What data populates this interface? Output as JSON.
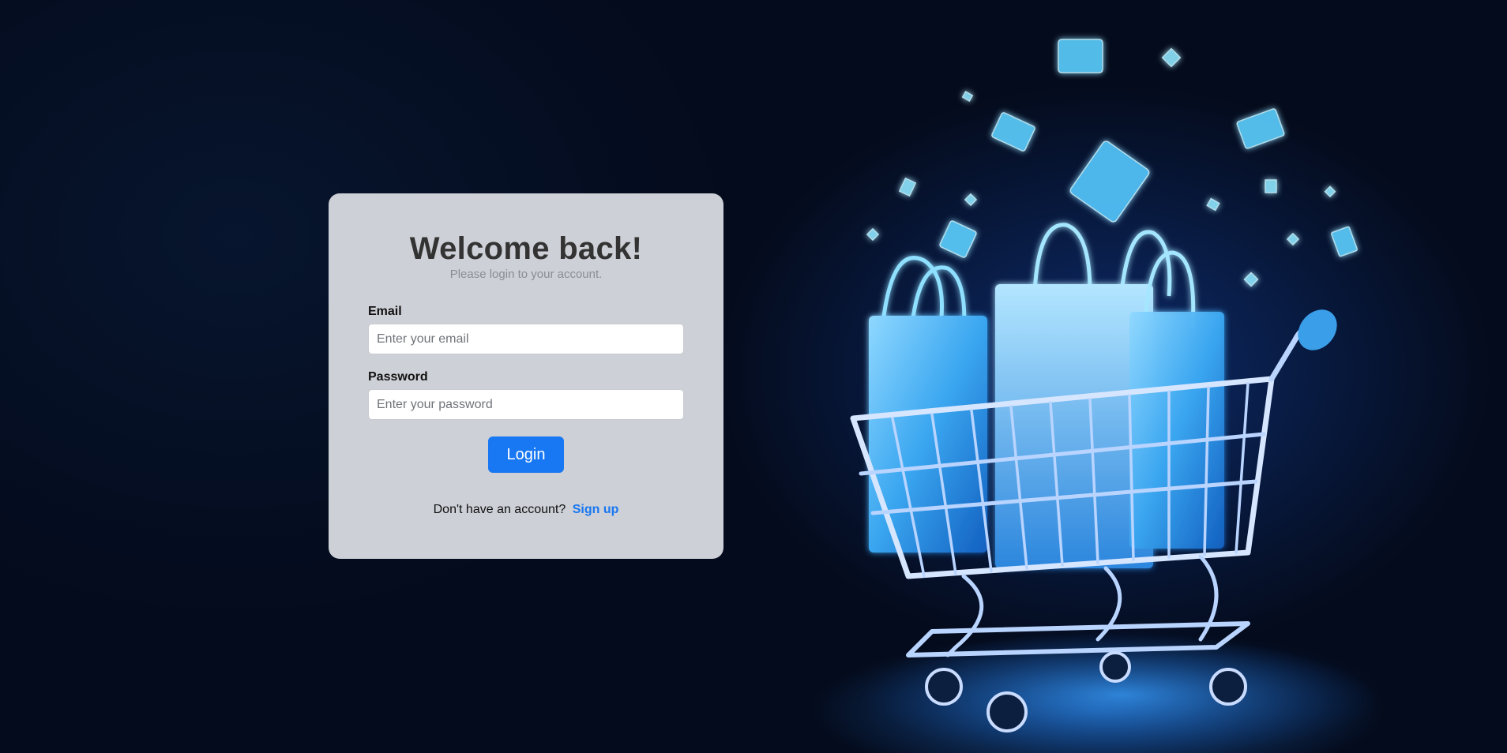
{
  "login": {
    "title": "Welcome back!",
    "subtitle": "Please login to your account.",
    "email_label": "Email",
    "email_placeholder": "Enter your email",
    "email_value": "",
    "password_label": "Password",
    "password_placeholder": "Enter your password",
    "password_value": "",
    "login_button": "Login",
    "signup_prompt": "Don't have an account?",
    "signup_link": "Sign up"
  },
  "hero": {
    "illustration": "shopping-cart-with-bags-and-floating-cards"
  },
  "colors": {
    "background": "#061230",
    "card_background": "#cdd0d6",
    "accent": "#1877f2",
    "glow": "#2a8cff"
  }
}
